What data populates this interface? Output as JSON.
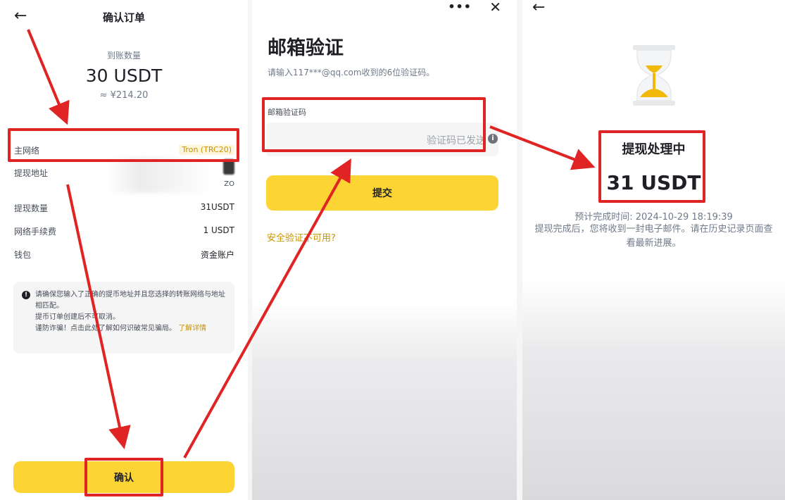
{
  "confirm_order": {
    "title": "确认订单",
    "receive_label": "到账数量",
    "receive_amount": "30 USDT",
    "receive_fiat": "≈ ¥214.20",
    "rows": {
      "network_label": "主网络",
      "network_value": "Tron (TRC20)",
      "address_label": "提现地址",
      "address_suffix": "ZO",
      "amount_label": "提现数量",
      "amount_value": "31USDT",
      "fee_label": "网络手续费",
      "fee_value": "1 USDT",
      "wallet_label": "钱包",
      "wallet_value": "资金账户"
    },
    "notice": {
      "line1": "请确保您输入了正确的提币地址并且您选择的转账网络与地址相匹配。",
      "line2": "提币订单创建后不可取消。",
      "line3": "谨防诈骗！点击此处了解如何识破常见骗局。",
      "link": "了解详情"
    },
    "confirm_button": "确认"
  },
  "email_verify": {
    "more": "•••",
    "close": "✕",
    "title": "邮箱验证",
    "description": "请输入117***@qq.com收到的6位验证码。",
    "field_label": "邮箱验证码",
    "code_sent": "验证码已发送",
    "submit_button": "提交",
    "unavailable_link": "安全验证不可用?"
  },
  "processing": {
    "title": "提现处理中",
    "amount": "31 USDT",
    "eta": "预计完成时间: 2024-10-29 18:19:39",
    "description": "提现完成后，您将收到一封电子邮件。请在历史记录页面查看最新进展。"
  },
  "colors": {
    "accent_yellow": "#fcd535",
    "link_gold": "#c99400",
    "annotation_red": "#e02424"
  }
}
